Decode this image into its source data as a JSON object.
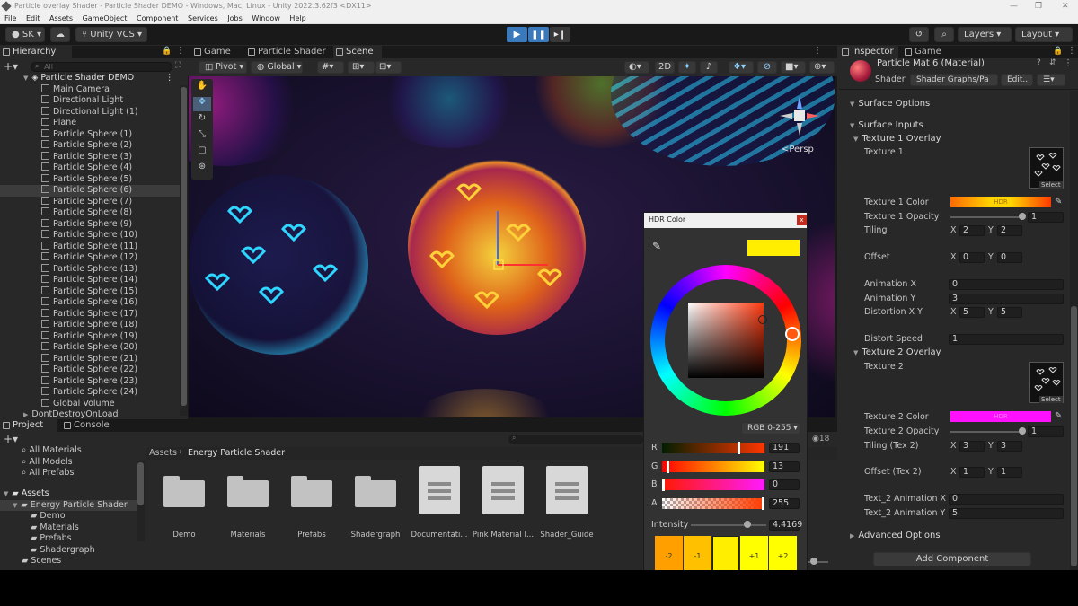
{
  "window": {
    "title": "Particle overlay Shader - Particle Shader DEMO - Windows, Mac, Linux - Unity 2022.3.62f3 <DX11>",
    "menu": [
      "File",
      "Edit",
      "Assets",
      "GameObject",
      "Component",
      "Services",
      "Jobs",
      "Window",
      "Help"
    ]
  },
  "toolbar": {
    "account": "SK",
    "vcs": "Unity VCS",
    "layers": "Layers",
    "layout": "Layout"
  },
  "hierarchy": {
    "tab": "Hierarchy",
    "search_placeholder": "All",
    "scene": "Particle Shader DEMO",
    "items": [
      "Main Camera",
      "Directional Light",
      "Directional Light (1)",
      "Plane",
      "Particle Sphere (1)",
      "Particle Sphere (2)",
      "Particle Sphere (3)",
      "Particle Sphere (4)",
      "Particle Sphere (5)",
      "Particle Sphere (6)",
      "Particle Sphere (7)",
      "Particle Sphere (8)",
      "Particle Sphere (9)",
      "Particle Sphere (10)",
      "Particle Sphere (11)",
      "Particle Sphere (12)",
      "Particle Sphere (13)",
      "Particle Sphere (14)",
      "Particle Sphere (15)",
      "Particle Sphere (16)",
      "Particle Sphere (17)",
      "Particle Sphere (18)",
      "Particle Sphere (19)",
      "Particle Sphere (20)",
      "Particle Sphere (21)",
      "Particle Sphere (22)",
      "Particle Sphere (23)",
      "Particle Sphere (24)",
      "Global Volume"
    ],
    "selected": "Particle Sphere (6)",
    "dont_destroy": "DontDestroyOnLoad"
  },
  "center_tabs": [
    "Game",
    "Particle Shader",
    "Scene"
  ],
  "scene_toolbar": {
    "pivot": "Pivot",
    "global": "Global",
    "mode_2d": "2D",
    "persp": "<Persp"
  },
  "project": {
    "tabs": [
      "Project",
      "Console"
    ],
    "favorites": [
      "All Materials",
      "All Models",
      "All Prefabs"
    ],
    "assets_root": "Assets",
    "tree": [
      "Energy Particle Shader",
      "Demo",
      "Materials",
      "Prefabs",
      "Shadergraph",
      "Scenes"
    ],
    "breadcrumb_root": "Assets",
    "breadcrumb_current": "Energy Particle Shader",
    "count": "18",
    "files": [
      "Demo",
      "Materials",
      "Prefabs",
      "Shadergraph",
      "Documentati...",
      "Pink Material I...",
      "Shader_Guide"
    ]
  },
  "hdr": {
    "title": "HDR Color",
    "mode": "RGB 0-255",
    "channels": [
      {
        "label": "R",
        "value": "191"
      },
      {
        "label": "G",
        "value": "13"
      },
      {
        "label": "B",
        "value": "0"
      },
      {
        "label": "A",
        "value": "255"
      }
    ],
    "intensity_label": "Intensity",
    "intensity_value": "4.4169",
    "intensity_fraction": 0.75,
    "swatches": [
      "-2",
      "-1",
      "",
      "+1",
      "+2"
    ],
    "preview_color": "#ffee00"
  },
  "inspector": {
    "tabs": [
      "Inspector",
      "Game"
    ],
    "material_title": "Particle Mat 6 (Material)",
    "shader_label": "Shader",
    "shader_value": "Shader Graphs/Pa",
    "edit_button": "Edit...",
    "surface_options": "Surface Options",
    "surface_inputs": "Surface Inputs",
    "tex1_group": "Texture 1 Overlay",
    "tex1": "Texture 1",
    "select": "Select",
    "tex1_color": "Texture 1 Color",
    "hdr_badge": "HDR",
    "tex1_opacity": "Texture 1 Opacity",
    "tex1_opacity_value": "1",
    "tiling": "Tiling",
    "tiling_x": "2",
    "tiling_y": "2",
    "offset": "Offset",
    "offset_x": "0",
    "offset_y": "0",
    "anim_x": "Animation X",
    "anim_x_value": "0",
    "anim_y": "Animation Y",
    "anim_y_value": "3",
    "distortion": "Distortion X Y",
    "distortion_x": "5",
    "distortion_y": "5",
    "distort_speed": "Distort Speed",
    "distort_speed_value": "1",
    "tex2_group": "Texture 2 Overlay",
    "tex2": "Texture 2",
    "tex2_color": "Texture 2 Color",
    "tex2_opacity": "Texture 2 Opacity",
    "tex2_opacity_value": "1",
    "tiling2": "Tiling (Tex 2)",
    "tiling2_x": "3",
    "tiling2_y": "3",
    "offset2": "Offset (Tex 2)",
    "offset2_x": "1",
    "offset2_y": "1",
    "t2anim_x": "Text_2 Animation X",
    "t2anim_x_value": "0",
    "t2anim_y": "Text_2 Animation Y",
    "t2anim_y_value": "5",
    "advanced": "Advanced Options",
    "add_component": "Add Component",
    "x": "X",
    "y": "Y"
  }
}
